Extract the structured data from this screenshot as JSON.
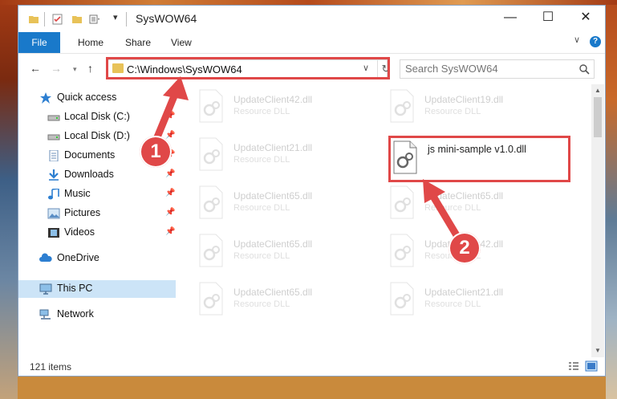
{
  "window": {
    "title": "SysWOW64",
    "controls": {
      "minimize": "—",
      "maximize": "☐",
      "close": "✕"
    }
  },
  "ribbon": {
    "tabs": [
      {
        "label": "File"
      },
      {
        "label": "Home"
      },
      {
        "label": "Share"
      },
      {
        "label": "View"
      }
    ],
    "help": "?"
  },
  "address": {
    "path": "C:\\Windows\\SysWOW64",
    "search_placeholder": "Search SysWOW64"
  },
  "sidebar": {
    "items": [
      {
        "label": "Quick access",
        "icon": "star-icon"
      },
      {
        "label": "Local Disk (C:)",
        "icon": "drive-icon",
        "pinned": true
      },
      {
        "label": "Local Disk (D:)",
        "icon": "drive-icon",
        "pinned": true
      },
      {
        "label": "Documents",
        "icon": "documents-icon",
        "pinned": true
      },
      {
        "label": "Downloads",
        "icon": "download-icon",
        "pinned": true
      },
      {
        "label": "Music",
        "icon": "music-icon",
        "pinned": true
      },
      {
        "label": "Pictures",
        "icon": "pictures-icon",
        "pinned": true
      },
      {
        "label": "Videos",
        "icon": "videos-icon",
        "pinned": true
      },
      {
        "label": "OneDrive",
        "icon": "cloud-icon"
      },
      {
        "label": "This PC",
        "icon": "computer-icon",
        "selected": true
      },
      {
        "label": "Network",
        "icon": "network-icon"
      }
    ]
  },
  "files": {
    "left": [
      {
        "name": "UpdateClient42.dll",
        "type": "Resource DLL"
      },
      {
        "name": "UpdateClient21.dll",
        "type": "Resource DLL"
      },
      {
        "name": "UpdateClient65.dll",
        "type": "Resource DLL"
      },
      {
        "name": "UpdateClient65.dll",
        "type": "Resource DLL"
      },
      {
        "name": "UpdateClient65.dll",
        "type": "Resource DLL"
      }
    ],
    "right": [
      {
        "name": "UpdateClient19.dll",
        "type": "Resource DLL"
      },
      {
        "name": "js mini-sample v1.0.dll",
        "type": "",
        "highlighted": true
      },
      {
        "name": "UpdateClient65.dll",
        "type": "Resource DLL"
      },
      {
        "name": "UpdateClient42.dll",
        "type": "Resource DLL"
      },
      {
        "name": "UpdateClient21.dll",
        "type": "Resource DLL"
      }
    ]
  },
  "status": {
    "item_count": "121 items"
  },
  "annotations": {
    "step1": "1",
    "step2": "2",
    "color": "#e04848"
  }
}
